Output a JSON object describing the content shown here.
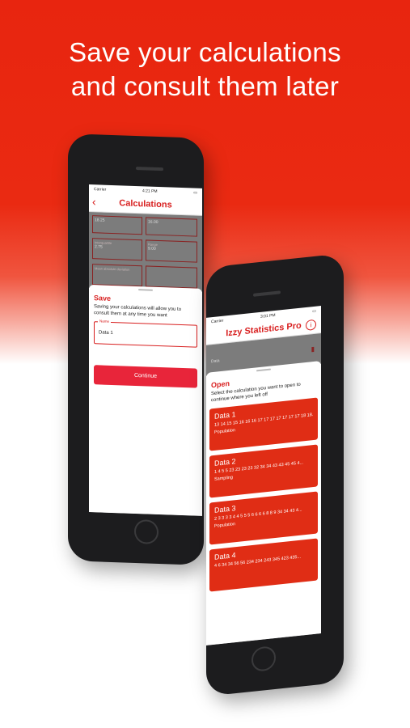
{
  "headline": {
    "line1": "Save your calculations",
    "line2": "and consult them later"
  },
  "phone1": {
    "status": {
      "carrier": "Carrier",
      "time": "4:21 PM"
    },
    "nav": {
      "back_icon": "‹",
      "title": "Calculations"
    },
    "bg_fields": [
      {
        "label": "",
        "value": "18.25"
      },
      {
        "label": "",
        "value": "16.00"
      },
      {
        "label": "Interquartile",
        "value": "2.75"
      },
      {
        "label": "Range",
        "value": "9.00"
      },
      {
        "label": "Mean absolute deviation",
        "value": ""
      },
      {
        "label": "",
        "value": ""
      }
    ],
    "sheet": {
      "title": "Save",
      "description": "Saving your calculations will allow you to consult them at any time you want",
      "name_label": "Name",
      "name_value": "Data 1",
      "continue_label": "Continue"
    }
  },
  "phone2": {
    "status": {
      "carrier": "Carrier",
      "time": "3:01 PM"
    },
    "nav": {
      "title": "Izzy Statistics Pro",
      "info_icon": "i"
    },
    "bg_field_value": "Data",
    "sheet": {
      "title": "Open",
      "description": "Select the calculation you want to open to continue where you left off",
      "items": [
        {
          "title": "Data 1",
          "values": "13 14 15 15 16 16 16 17 17 17 17 17 17 17 18 18...",
          "type": "Population"
        },
        {
          "title": "Data 2",
          "values": "1 4 5 5 23 23 23 23 32 34 34 43 43 45 45 4...",
          "type": "Sampling"
        },
        {
          "title": "Data 3",
          "values": "2 3 3 3 3 4 4 5 5 5 6 6 6 6 8 8 9 34 34 43 4...",
          "type": "Population"
        },
        {
          "title": "Data 4",
          "values": "4 6 34 34 56 56 234 234 243 345 423 435...",
          "type": ""
        }
      ]
    }
  },
  "colors": {
    "accent": "#e02d15",
    "button": "#e8253a",
    "title_red": "#d81f1f"
  }
}
